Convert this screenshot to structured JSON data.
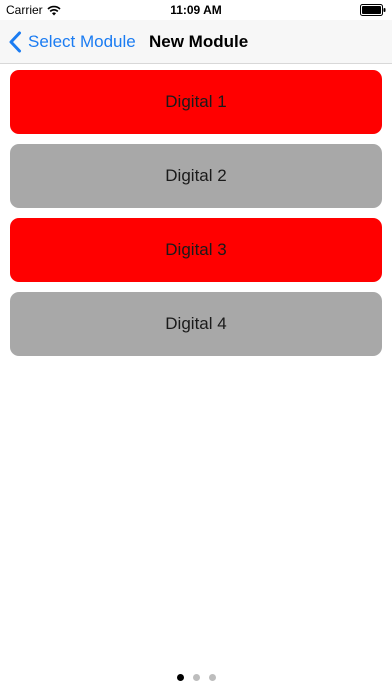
{
  "status_bar": {
    "carrier": "Carrier",
    "time": "11:09 AM",
    "wifi_icon": "wifi-icon",
    "battery_icon": "battery-icon"
  },
  "nav": {
    "back_label": "Select Module",
    "back_icon": "chevron-left-icon",
    "title": "New Module",
    "accent_color": "#1b7cf2"
  },
  "modules": [
    {
      "label": "Digital 1",
      "state": "on",
      "color": "#ff0000"
    },
    {
      "label": "Digital 2",
      "state": "off",
      "color": "#a8a8a8"
    },
    {
      "label": "Digital 3",
      "state": "on",
      "color": "#ff0000"
    },
    {
      "label": "Digital 4",
      "state": "off",
      "color": "#a8a8a8"
    }
  ],
  "page_control": {
    "page_count": 3,
    "current_page": 1,
    "active_color": "#000000",
    "inactive_color": "#bdbdbd"
  }
}
